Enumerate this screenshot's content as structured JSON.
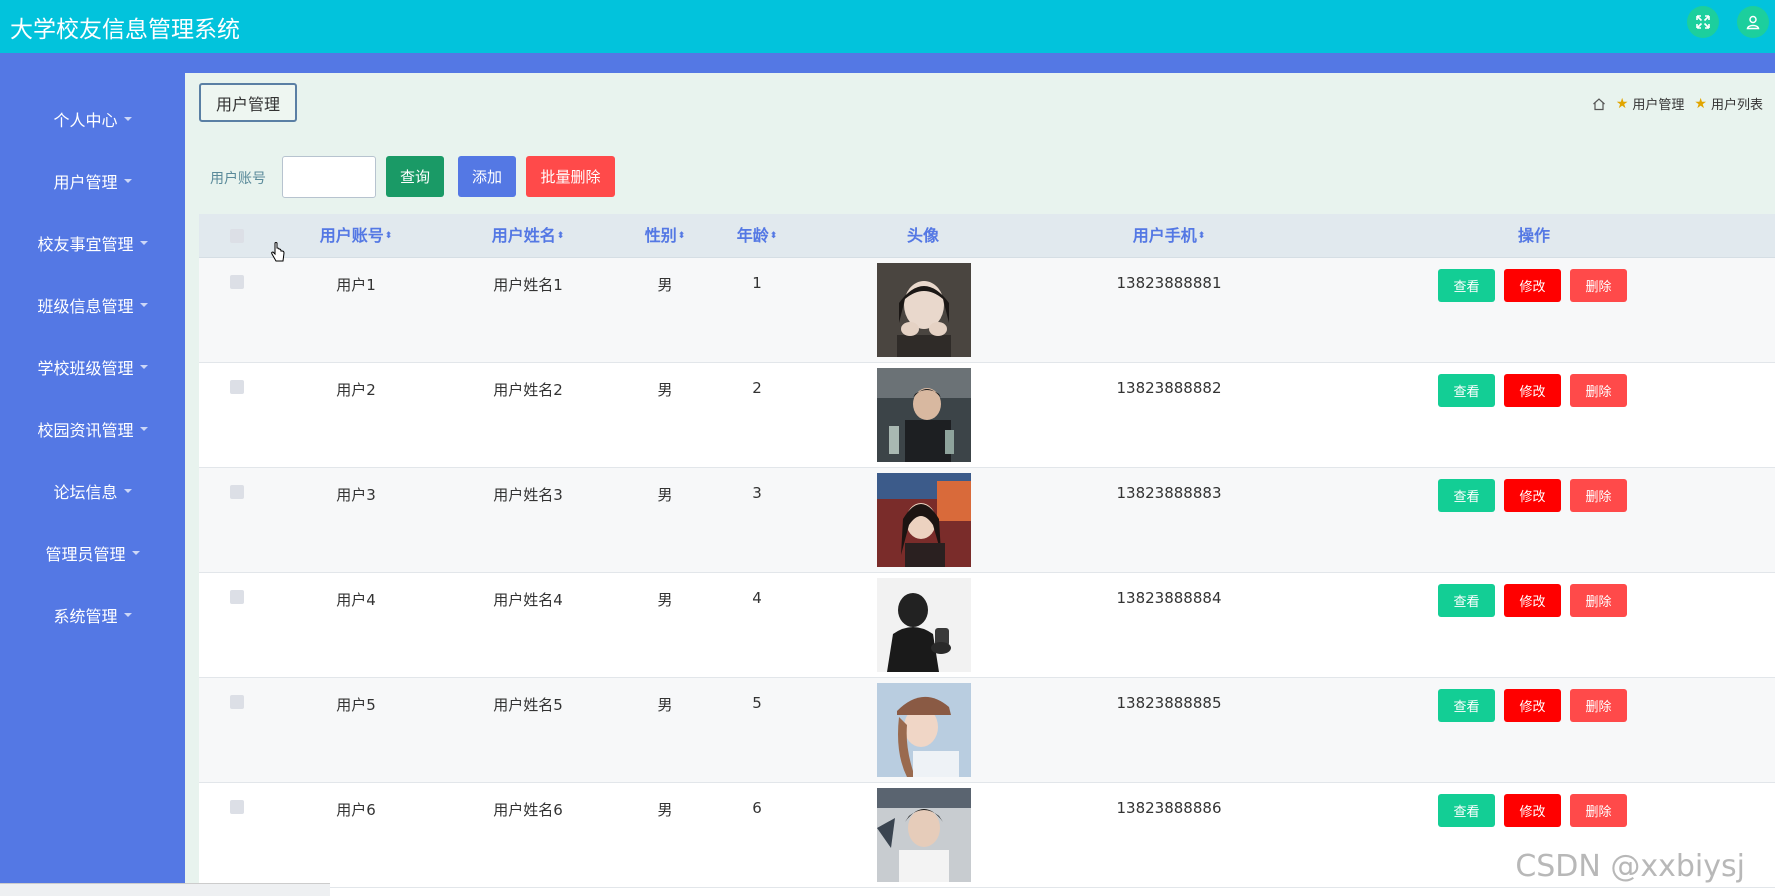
{
  "header": {
    "title": "大学校友信息管理系统"
  },
  "sidebar": {
    "items": [
      {
        "label": "个人中心"
      },
      {
        "label": "用户管理"
      },
      {
        "label": "校友事宜管理"
      },
      {
        "label": "班级信息管理"
      },
      {
        "label": "学校班级管理"
      },
      {
        "label": "校园资讯管理"
      },
      {
        "label": "论坛信息"
      },
      {
        "label": "管理员管理"
      },
      {
        "label": "系统管理"
      }
    ]
  },
  "page": {
    "tab_label": "用户管理",
    "breadcrumb": [
      "用户管理",
      "用户列表"
    ]
  },
  "search": {
    "label": "用户账号",
    "value": "",
    "query_button": "查询",
    "add_button": "添加",
    "batch_delete_button": "批量删除"
  },
  "table": {
    "headers": {
      "account": "用户账号",
      "name": "用户姓名",
      "gender": "性别",
      "age": "年龄",
      "avatar": "头像",
      "phone": "用户手机",
      "actions": "操作"
    },
    "sort_icon": "⬍",
    "action_labels": {
      "view": "查看",
      "edit": "修改",
      "delete": "删除"
    },
    "rows": [
      {
        "account": "用户1",
        "name": "用户姓名1",
        "gender": "男",
        "age": "1",
        "phone": "13823888881"
      },
      {
        "account": "用户2",
        "name": "用户姓名2",
        "gender": "男",
        "age": "2",
        "phone": "13823888882"
      },
      {
        "account": "用户3",
        "name": "用户姓名3",
        "gender": "男",
        "age": "3",
        "phone": "13823888883"
      },
      {
        "account": "用户4",
        "name": "用户姓名4",
        "gender": "男",
        "age": "4",
        "phone": "13823888884"
      },
      {
        "account": "用户5",
        "name": "用户姓名5",
        "gender": "男",
        "age": "5",
        "phone": "13823888885"
      },
      {
        "account": "用户6",
        "name": "用户姓名6",
        "gender": "男",
        "age": "6",
        "phone": "13823888886"
      }
    ]
  },
  "watermark": "CSDN @xxbiysj",
  "colors": {
    "header": "#02c3dc",
    "sidebar": "#5478e4",
    "query": "#1a9a66",
    "add": "#5478e4",
    "batch_delete": "#ff4a4a",
    "view": "#13ce95",
    "edit": "#ff0000",
    "delete": "#ff4a4a"
  },
  "icons": {
    "fullscreen": "fullscreen-icon",
    "user": "user-icon",
    "home": "home-icon",
    "star": "star-icon"
  }
}
